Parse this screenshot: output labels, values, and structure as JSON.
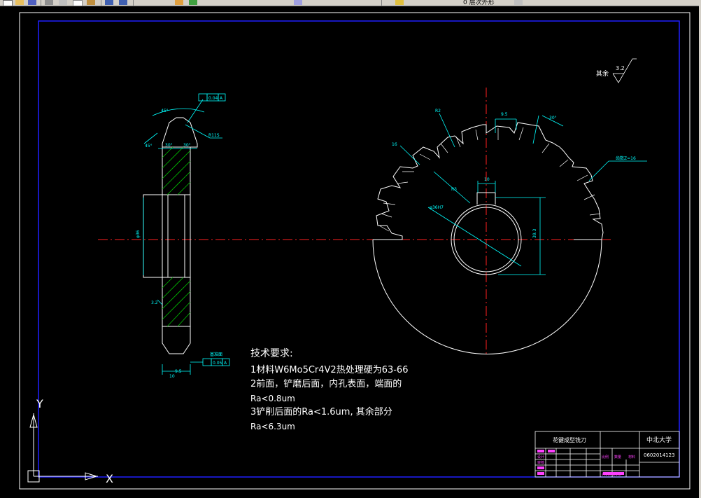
{
  "toolbar": {
    "layer_label": "0 层次外形",
    "icons": [
      "new-icon",
      "open-icon",
      "save-icon",
      "print-icon",
      "cut-icon",
      "copy-icon",
      "paste-icon",
      "undo-icon",
      "redo-icon",
      "pan-icon",
      "zoom-icon",
      "properties-icon",
      "layer-icon",
      "layer-dropdown-icon"
    ]
  },
  "drawing": {
    "dims": {
      "angle_top": "45°",
      "tol_top_a": "0.04",
      "tol_ref_a": "A",
      "radius_r": "R11S",
      "chamfer_left": "45°",
      "angle_a1": "30°",
      "angle_a2": "30°",
      "width_total": "10",
      "width_core": "9.5",
      "bore_v": "φ36",
      "side_ra": "3.2",
      "tol_bottom_a": "0.05",
      "tol_ref_b": "A",
      "datum_bottom": "基准面",
      "teeth_count": "齿数Z=16",
      "tip_r1": "R2",
      "tip_r2": "R2",
      "gap_w": "9.5",
      "angle_right": "30°",
      "slot_w": "10",
      "radius_c": "R3",
      "bore_d": "φ36H7",
      "keyway_h": "39.3",
      "dim_left": "16",
      "rest_ra_label": "其余",
      "rest_ra_val": "3.2"
    },
    "notes": {
      "heading": "技术要求:",
      "lines": [
        "1材料W6Mo5Cr4V2热处理硬为63-66",
        "2前面，铲磨后面，内孔表面，端面的",
        "Ra<0.8um",
        "3铲削后面的Ra<1.6um, 其余部分",
        "Ra<6.3um"
      ]
    },
    "title_block": {
      "part_name": "花键成型铣刀",
      "school": "中北大学",
      "drawing_no": "0602014123",
      "scale_label": "比例",
      "qty_label": "数量",
      "material_label": "材料",
      "designer_label": "设计",
      "checker_label": "审核",
      "sheet": "共1张 第1张"
    },
    "ucs": {
      "x": "X",
      "y": "Y"
    }
  }
}
